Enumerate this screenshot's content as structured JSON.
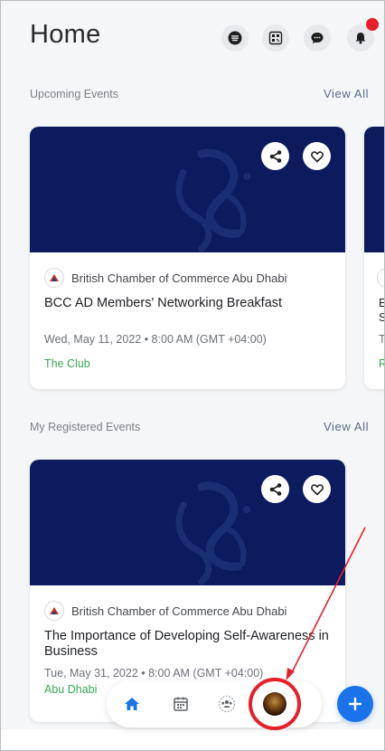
{
  "header": {
    "title": "Home",
    "icons": [
      "menu-icon",
      "qr-code-icon",
      "chat-icon",
      "notification-bell-icon"
    ],
    "notification_badge": true
  },
  "upcoming": {
    "label": "Upcoming Events",
    "view_all": "View All",
    "card": {
      "org": "British Chamber of Commerce Abu Dhabi",
      "title": "BCC AD Members' Networking Breakfast",
      "date": "Wed, May  11, 2022 • 8:00 AM (GMT +04:00)",
      "location": "The Club"
    },
    "partial_card": {
      "line1": "E",
      "line2": "S",
      "line3": "T",
      "line4": "R"
    }
  },
  "registered": {
    "label": "My Registered Events",
    "view_all": "View All",
    "card": {
      "org": "British Chamber of Commerce Abu Dhabi",
      "title": "The Importance of Developing Self-Awareness in Business",
      "date": "Tue, May  31, 2022 • 8:00 AM (GMT +04:00)",
      "location": "Abu Dhabi"
    }
  },
  "bottom_nav": {
    "items": [
      "home-icon",
      "calendar-icon",
      "community-icon",
      "profile-avatar"
    ],
    "active": "home-icon"
  },
  "colors": {
    "banner": "#0b1b5e",
    "accent": "#1a73e8",
    "location_green": "#34a853",
    "annotation_red": "#e5202a"
  }
}
